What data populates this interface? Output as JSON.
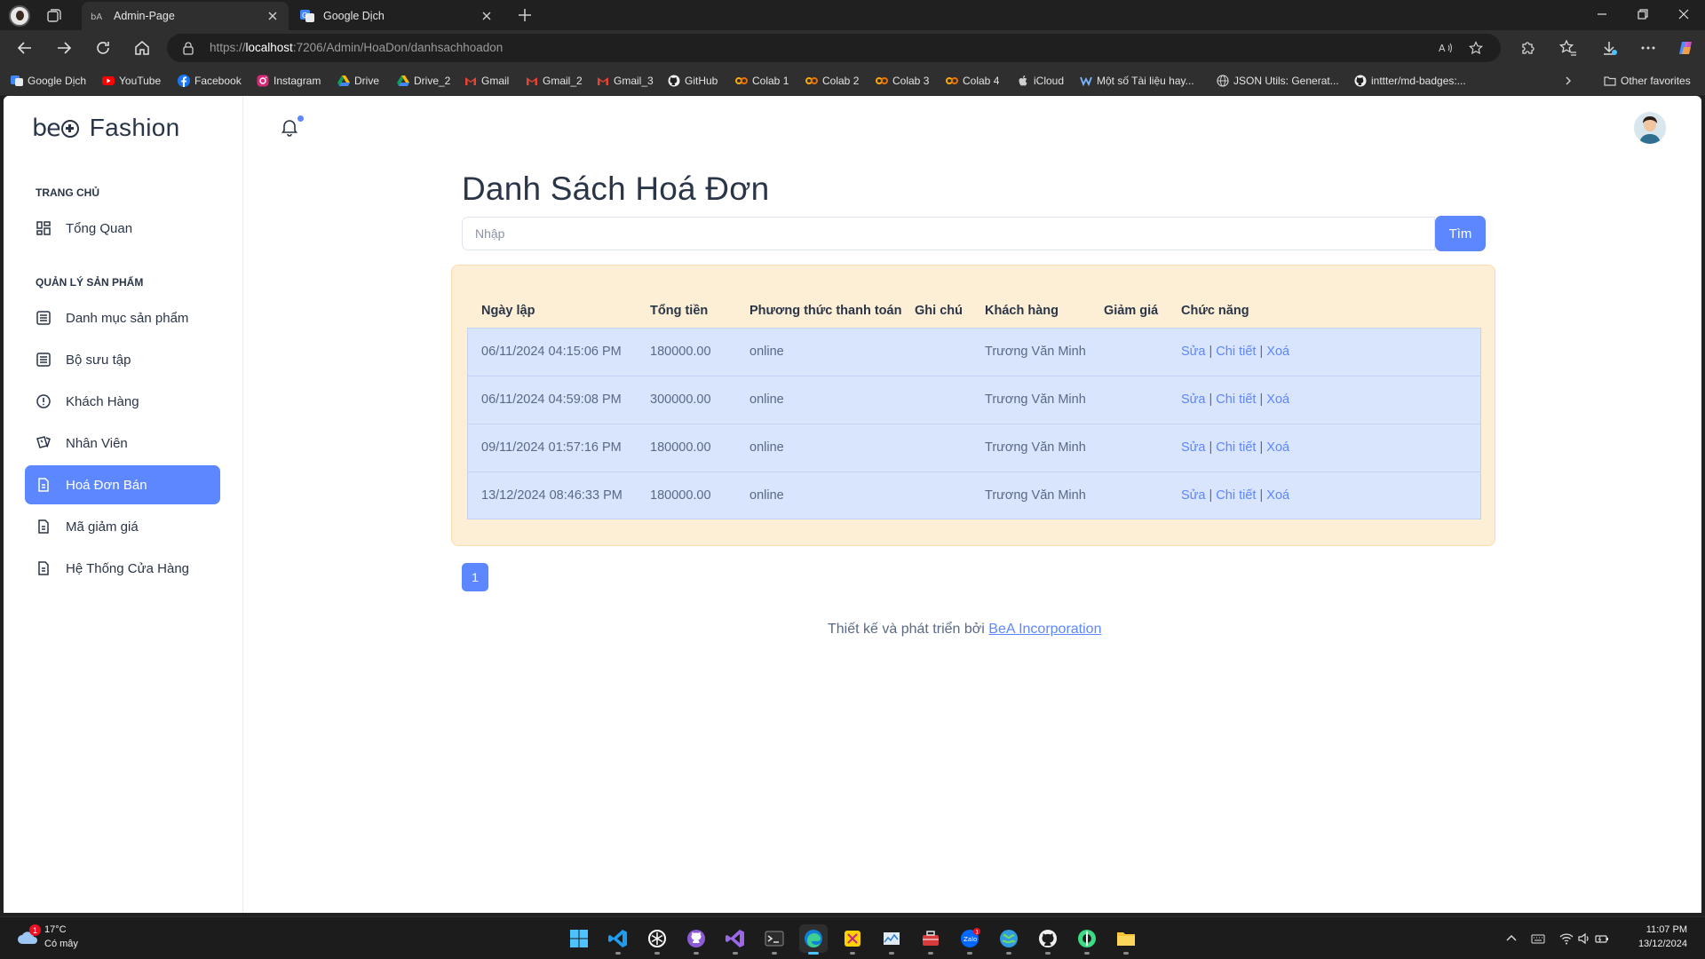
{
  "browser": {
    "tabs": [
      {
        "title": "Admin-Page",
        "active": true
      },
      {
        "title": "Google Dịch",
        "active": false
      }
    ],
    "url_prefix": "https://",
    "url_host": "localhost",
    "url_path": ":7206/Admin/HoaDon/danhsachhoadon",
    "bookmarks": [
      {
        "label": "Google Dịch",
        "icon": "google-translate-icon"
      },
      {
        "label": "YouTube",
        "icon": "youtube-icon"
      },
      {
        "label": "Facebook",
        "icon": "facebook-icon"
      },
      {
        "label": "Instagram",
        "icon": "instagram-icon"
      },
      {
        "label": "Drive",
        "icon": "drive-icon"
      },
      {
        "label": "Drive_2",
        "icon": "drive-icon"
      },
      {
        "label": "Gmail",
        "icon": "gmail-icon"
      },
      {
        "label": "Gmail_2",
        "icon": "gmail-icon"
      },
      {
        "label": "Gmail_3",
        "icon": "gmail-icon"
      },
      {
        "label": "GitHub",
        "icon": "github-icon"
      },
      {
        "label": "Colab 1",
        "icon": "colab-icon"
      },
      {
        "label": "Colab 2",
        "icon": "colab-icon"
      },
      {
        "label": "Colab 3",
        "icon": "colab-icon"
      },
      {
        "label": "Colab 4",
        "icon": "colab-icon"
      },
      {
        "label": "iCloud",
        "icon": "apple-icon"
      },
      {
        "label": "Một số Tài liệu hay...",
        "icon": "bookmark-m-icon"
      },
      {
        "label": "JSON Utils: Generat...",
        "icon": "globe-icon"
      },
      {
        "label": "inttter/md-badges:...",
        "icon": "github-icon"
      }
    ],
    "other_favorites": "Other favorites"
  },
  "sidebar": {
    "logo_mark": "beA",
    "logo_text": "Fashion",
    "sections": [
      {
        "title": "TRANG CHỦ",
        "items": [
          {
            "label": "Tổng Quan",
            "icon": "dashboard-icon"
          }
        ]
      },
      {
        "title": "QUẢN LÝ SẢN PHẨM",
        "items": [
          {
            "label": "Danh mục sản phẩm",
            "icon": "list-icon"
          },
          {
            "label": "Bộ sưu tập",
            "icon": "list-icon"
          },
          {
            "label": "Khách Hàng",
            "icon": "alert-circle-icon"
          },
          {
            "label": "Nhân Viên",
            "icon": "cards-icon"
          },
          {
            "label": "Hoá Đơn Bán",
            "icon": "file-icon",
            "active": true
          },
          {
            "label": "Mã giảm giá",
            "icon": "file-icon"
          },
          {
            "label": "Hệ Thống Cửa Hàng",
            "icon": "file-icon"
          }
        ]
      }
    ]
  },
  "main": {
    "title": "Danh Sách Hoá Đơn",
    "search": {
      "placeholder": "Nhập",
      "value": "",
      "button": "Tìm"
    },
    "table": {
      "columns": [
        "Ngày lập",
        "Tổng tiền",
        "Phương thức thanh toán",
        "Ghi chú",
        "Khách hàng",
        "Giảm giá",
        "Chức năng"
      ],
      "rows": [
        {
          "date": "06/11/2024 04:15:06 PM",
          "total": "180000.00",
          "payment": "online",
          "note": "",
          "customer": "Trương Văn Minh",
          "discount": ""
        },
        {
          "date": "06/11/2024 04:59:08 PM",
          "total": "300000.00",
          "payment": "online",
          "note": "",
          "customer": "Trương Văn Minh",
          "discount": ""
        },
        {
          "date": "09/11/2024 01:57:16 PM",
          "total": "180000.00",
          "payment": "online",
          "note": "",
          "customer": "Trương Văn Minh",
          "discount": ""
        },
        {
          "date": "13/12/2024 08:46:33 PM",
          "total": "180000.00",
          "payment": "online",
          "note": "",
          "customer": "Trương Văn Minh",
          "discount": ""
        }
      ],
      "actions": {
        "edit": "Sửa",
        "detail": "Chi tiết",
        "delete": "Xoá",
        "separator": "|"
      }
    },
    "pagination": {
      "current": "1"
    },
    "footer": {
      "text": "Thiết kế và phát triển bởi",
      "link": "BeA Incorporation"
    }
  },
  "taskbar": {
    "weather": {
      "temp": "17°C",
      "desc": "Có mây",
      "badge": "1"
    },
    "apps": [
      {
        "name": "windows-start-icon"
      },
      {
        "name": "vscode-icon"
      },
      {
        "name": "chatgpt-icon"
      },
      {
        "name": "github-desktop-icon"
      },
      {
        "name": "visual-studio-icon"
      },
      {
        "name": "terminal-icon"
      },
      {
        "name": "edge-icon",
        "active": true
      },
      {
        "name": "snipping-icon"
      },
      {
        "name": "resource-monitor-icon"
      },
      {
        "name": "toolbox-icon"
      },
      {
        "name": "zalo-icon",
        "badge": "1"
      },
      {
        "name": "globe-app-icon"
      },
      {
        "name": "github-icon"
      },
      {
        "name": "android-studio-icon"
      },
      {
        "name": "file-explorer-icon"
      }
    ],
    "clock": {
      "time": "11:07 PM",
      "date": "13/12/2024"
    }
  },
  "colors": {
    "accent": "#5d87ff",
    "card_bg": "#fdefd6",
    "row_bg": "#d9e4fd",
    "text": "#2a3547"
  }
}
